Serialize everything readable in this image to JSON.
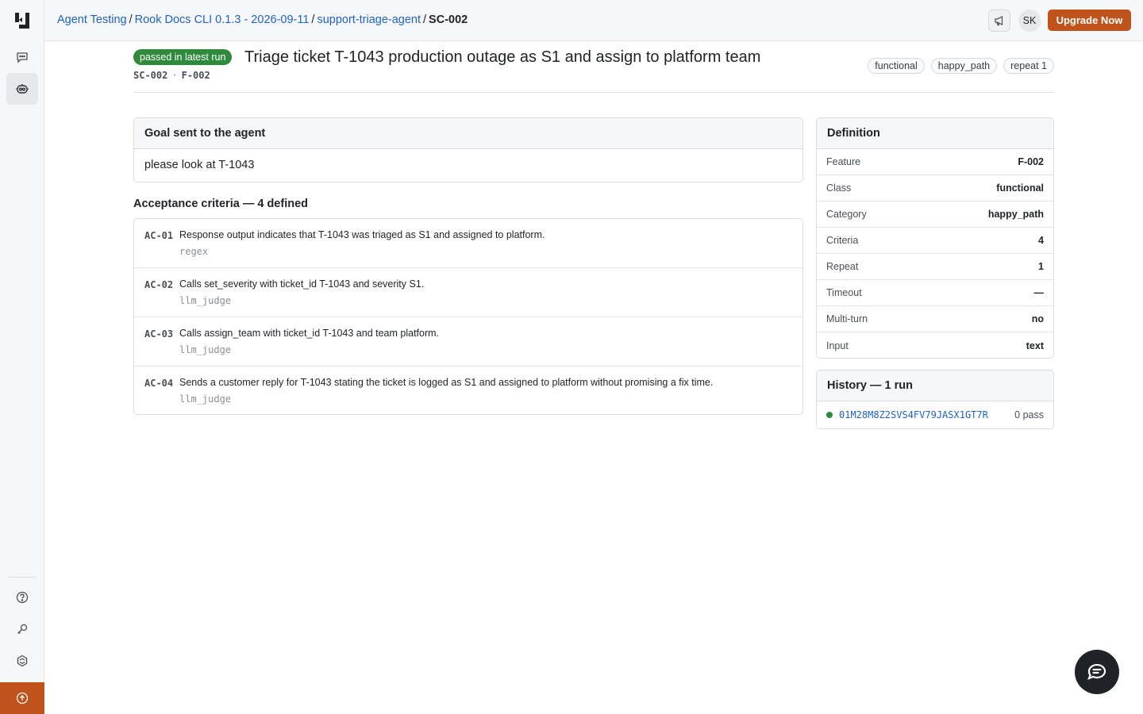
{
  "colors": {
    "accent": "#c0531b",
    "link": "#1f62c7",
    "success": "#2f8a3e"
  },
  "sidebar": {
    "items": [
      {
        "icon": "chat-icon"
      },
      {
        "icon": "agent-testing-icon",
        "active": true
      },
      {
        "icon": "help-icon"
      },
      {
        "icon": "key-icon"
      },
      {
        "icon": "settings-icon"
      },
      {
        "icon": "upload-icon"
      }
    ]
  },
  "header": {
    "breadcrumbs": [
      "Agent Testing",
      "Rook Docs CLI 0.1.3 - 2026-09-11",
      "support-triage-agent"
    ],
    "current": "SC-002",
    "separator": "/",
    "avatar_initials": "SK",
    "upgrade_label": "Upgrade Now"
  },
  "scenario": {
    "status": "passed in latest run",
    "title": "Triage ticket T-1043 production outage as S1 and assign to platform team",
    "id": "SC-002",
    "feature": "F-002",
    "id_separator": "·",
    "tags": [
      "functional",
      "happy_path",
      "repeat 1"
    ]
  },
  "goal": {
    "heading": "Goal sent to the agent",
    "text": "please look at T-1043"
  },
  "acceptance": {
    "heading": "Acceptance criteria — 4 defined",
    "items": [
      {
        "id": "AC-01",
        "text": "Response output indicates that T-1043 was triaged as S1 and assigned to platform.",
        "type": "regex"
      },
      {
        "id": "AC-02",
        "text": "Calls set_severity with ticket_id T-1043 and severity S1.",
        "type": "llm_judge"
      },
      {
        "id": "AC-03",
        "text": "Calls assign_team with ticket_id T-1043 and team platform.",
        "type": "llm_judge"
      },
      {
        "id": "AC-04",
        "text": "Sends a customer reply for T-1043 stating the ticket is logged as S1 and assigned to platform without promising a fix time.",
        "type": "llm_judge"
      }
    ]
  },
  "definition": {
    "heading": "Definition",
    "rows": [
      {
        "key": "Feature",
        "value": "F-002"
      },
      {
        "key": "Class",
        "value": "functional"
      },
      {
        "key": "Category",
        "value": "happy_path"
      },
      {
        "key": "Criteria",
        "value": "4"
      },
      {
        "key": "Repeat",
        "value": "1"
      },
      {
        "key": "Timeout",
        "value": "—"
      },
      {
        "key": "Multi-turn",
        "value": "no"
      },
      {
        "key": "Input",
        "value": "text"
      }
    ]
  },
  "history": {
    "heading": "History — 1 run",
    "runs": [
      {
        "id": "01M28M8Z2SVS4FV79JASX1GT7R",
        "result": "0 pass"
      }
    ]
  }
}
